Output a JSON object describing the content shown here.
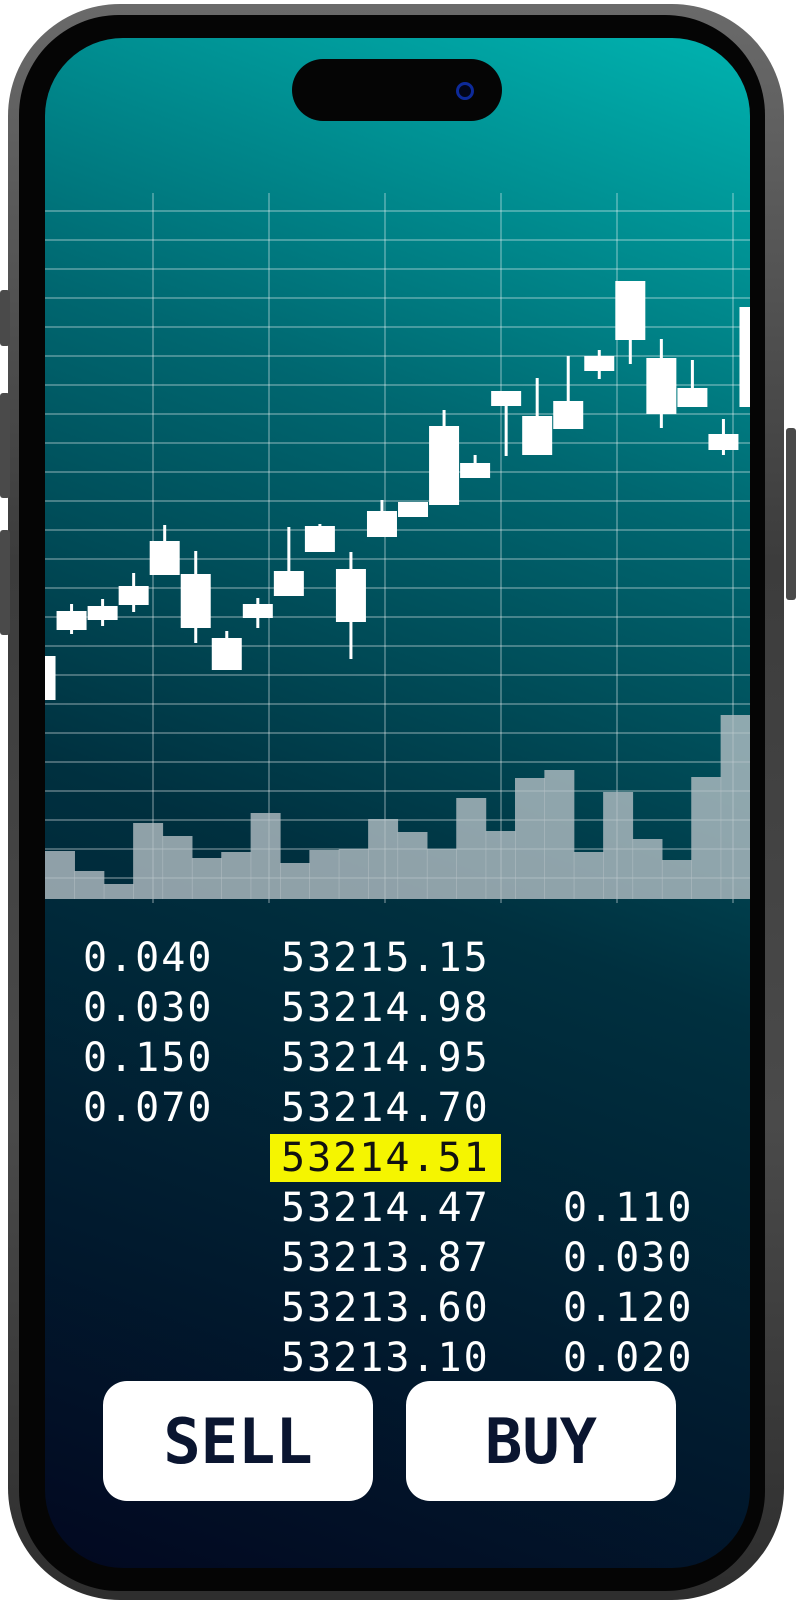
{
  "app": {
    "colors": {
      "highlight": "#f5f500",
      "button_text": "#0a1530",
      "candle": "#ffffff",
      "volume": "#b7c2c7"
    }
  },
  "chart_data": {
    "type": "candlestick",
    "x": [
      1,
      2,
      3,
      4,
      5,
      6,
      7,
      8,
      9,
      10,
      11,
      12,
      13,
      14,
      15,
      16,
      17,
      18,
      19,
      20,
      21,
      22,
      23,
      24
    ],
    "candles": [
      {
        "open": 620,
        "close": 660,
        "high": 610,
        "low": 668
      },
      {
        "open": 575,
        "close": 590,
        "high": 566,
        "low": 596
      },
      {
        "open": 570,
        "close": 580,
        "high": 561,
        "low": 588
      },
      {
        "open": 550,
        "close": 565,
        "high": 535,
        "low": 574
      },
      {
        "open": 505,
        "close": 535,
        "high": 487,
        "low": 535
      },
      {
        "open": 538,
        "close": 588,
        "high": 513,
        "low": 605
      },
      {
        "open": 602,
        "close": 630,
        "high": 593,
        "low": 630
      },
      {
        "open": 568,
        "close": 578,
        "high": 560,
        "low": 590
      },
      {
        "open": 535,
        "close": 556,
        "high": 489,
        "low": 556
      },
      {
        "open": 490,
        "close": 512,
        "high": 486,
        "low": 512
      },
      {
        "open": 533,
        "close": 582,
        "high": 514,
        "low": 621
      },
      {
        "open": 475,
        "close": 497,
        "high": 462,
        "low": 497
      },
      {
        "open": 466,
        "close": 477,
        "high": 466,
        "low": 477
      },
      {
        "open": 390,
        "close": 465,
        "high": 372,
        "low": 465
      },
      {
        "open": 427,
        "close": 438,
        "high": 417,
        "low": 438
      },
      {
        "open": 355,
        "close": 366,
        "high": 355,
        "low": 418
      },
      {
        "open": 380,
        "close": 415,
        "high": 340,
        "low": 415
      },
      {
        "open": 365,
        "close": 389,
        "high": 318,
        "low": 389
      },
      {
        "open": 320,
        "close": 331,
        "high": 312,
        "low": 341
      },
      {
        "open": 245,
        "close": 300,
        "high": 245,
        "low": 326
      },
      {
        "open": 322,
        "close": 374,
        "high": 301,
        "low": 390
      },
      {
        "open": 352,
        "close": 367,
        "high": 322,
        "low": 367
      },
      {
        "open": 398,
        "close": 410,
        "high": 381,
        "low": 417
      },
      {
        "open": 271,
        "close": 367,
        "high": 267,
        "low": 392
      }
    ],
    "volumes": [
      48,
      28,
      15,
      76,
      63,
      41,
      47,
      86,
      36,
      49,
      50,
      80,
      67,
      50,
      101,
      68,
      121,
      129,
      47,
      107,
      60,
      39,
      122,
      184
    ],
    "xlim": [
      0.5,
      24.5
    ],
    "grid": true,
    "title": "",
    "xlabel": "",
    "ylabel": ""
  },
  "orderbook": {
    "bids": [
      {
        "qty": "0.040",
        "price": "53215.15"
      },
      {
        "qty": "0.030",
        "price": "53214.98"
      },
      {
        "qty": "0.150",
        "price": "53214.95"
      },
      {
        "qty": "0.070",
        "price": "53214.70"
      }
    ],
    "current_price": "53214.51",
    "asks": [
      {
        "price": "53214.47",
        "qty": "0.110"
      },
      {
        "price": "53213.87",
        "qty": "0.030"
      },
      {
        "price": "53213.60",
        "qty": "0.120"
      },
      {
        "price": "53213.10",
        "qty": "0.020"
      }
    ]
  },
  "actions": {
    "sell_label": "SELL",
    "buy_label": "BUY"
  }
}
